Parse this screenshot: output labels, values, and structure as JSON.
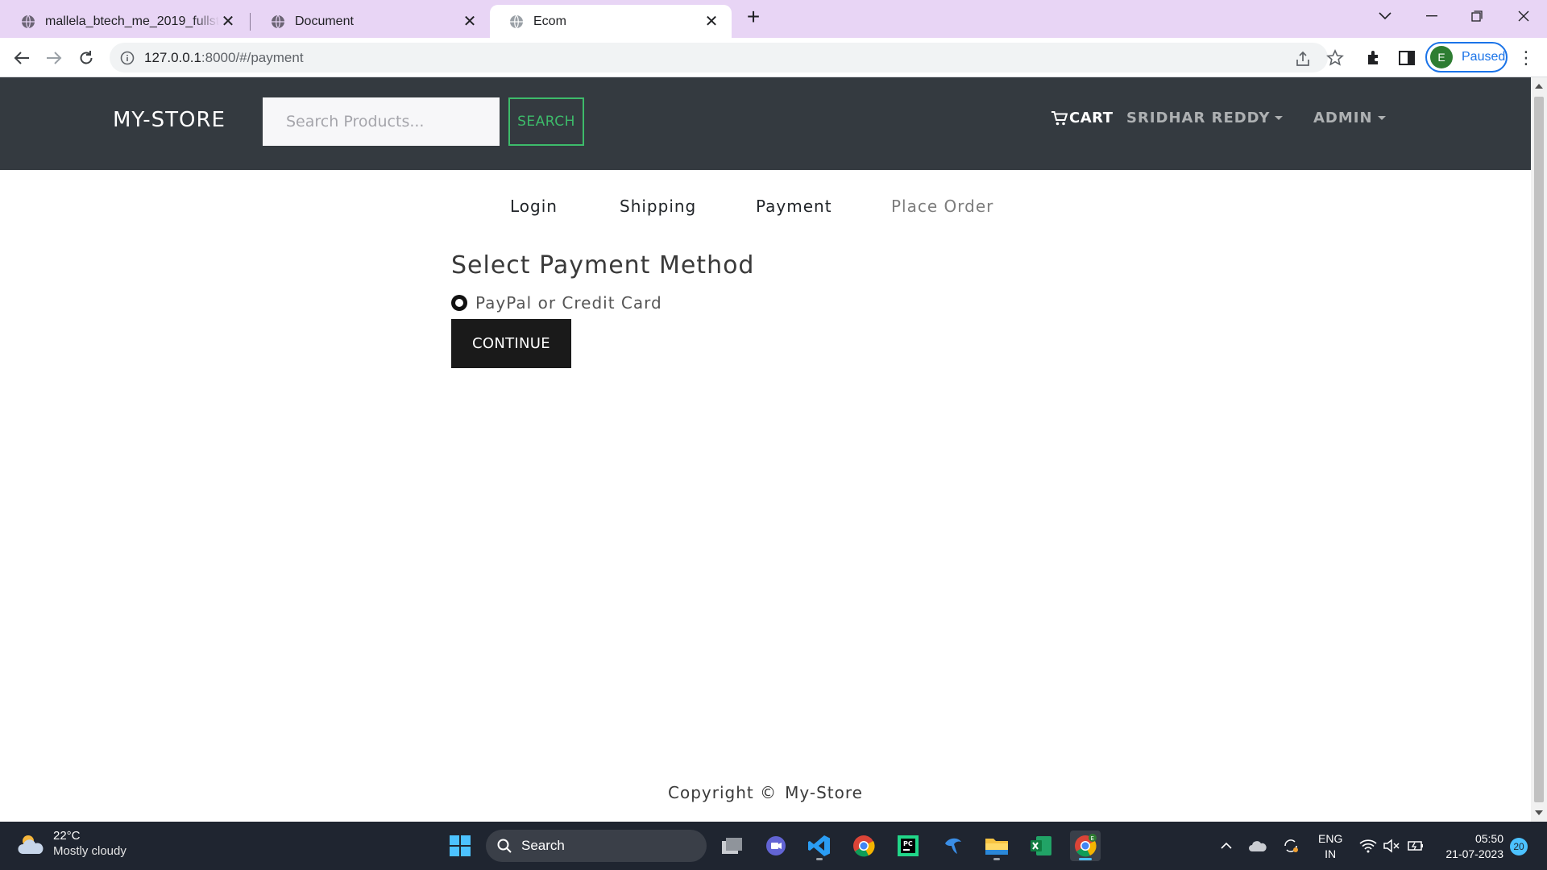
{
  "browser": {
    "tabs": [
      {
        "title": "mallela_btech_me_2019_fullstack_",
        "active": false
      },
      {
        "title": "Document",
        "active": false
      },
      {
        "title": "Ecom",
        "active": true
      }
    ],
    "url": {
      "host": "127.0.0.1",
      "rest": ":8000/#/payment"
    },
    "profile": {
      "initial": "E",
      "status": "Paused"
    }
  },
  "navbar": {
    "brand": "MY-STORE",
    "search_placeholder": "Search Products...",
    "search_button": "SEARCH",
    "cart_label": "CART",
    "user_menu": "SRIDHAR REDDY",
    "admin_menu": "ADMIN"
  },
  "checkout_steps": [
    {
      "label": "Login",
      "enabled": true
    },
    {
      "label": "Shipping",
      "enabled": true
    },
    {
      "label": "Payment",
      "enabled": true
    },
    {
      "label": "Place Order",
      "enabled": false
    }
  ],
  "payment": {
    "heading": "Select Payment Method",
    "option_label": "PayPal or Credit Card",
    "option_selected": true,
    "continue_button": "CONTINUE"
  },
  "footer": {
    "symbol": "Copyright ©",
    "text": "My-Store"
  },
  "taskbar": {
    "weather": {
      "temp": "22°C",
      "condition": "Mostly cloudy"
    },
    "search_label": "Search",
    "language": {
      "line1": "ENG",
      "line2": "IN"
    },
    "time": "05:50",
    "date": "21-07-2023",
    "notifications": "20"
  },
  "colors": {
    "navbar_bg": "#343a40",
    "search_accent": "#3dbb6a",
    "continue_bg": "#1a1a1a",
    "tabstrip_bg": "#e8d5f5",
    "taskbar_bg": "#1f2530"
  }
}
